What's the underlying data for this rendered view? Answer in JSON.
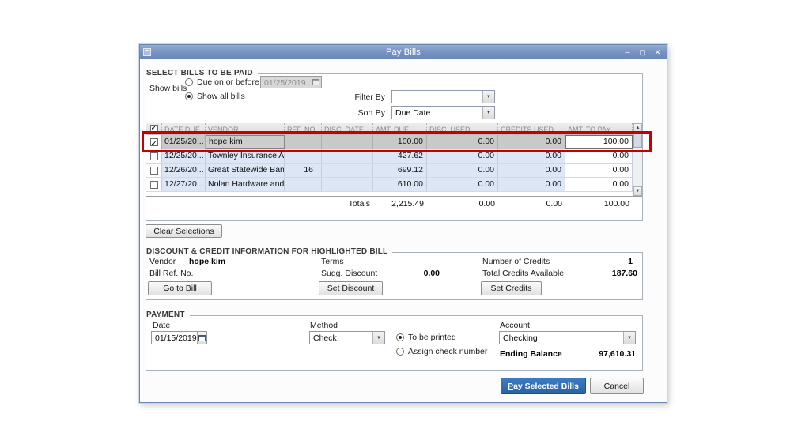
{
  "window": {
    "title": "Pay Bills"
  },
  "window_controls": {
    "minimize": "─",
    "maximize": "▢",
    "close": "✕"
  },
  "icons": {
    "chevron_down": "▼",
    "scroll_up": "▲",
    "scroll_down": "▼",
    "checkmark": "✓"
  },
  "select_bills": {
    "section_label": "SELECT BILLS TO BE PAID",
    "show_bills_label": "Show bills",
    "due_on_or_before": {
      "label": "Due on or before",
      "selected": false,
      "date": "01/25/2019"
    },
    "show_all_bills": {
      "label": "Show all bills",
      "selected": true
    },
    "filter_by": {
      "label": "Filter By",
      "value": ""
    },
    "sort_by": {
      "label": "Sort By",
      "value": "Due Date"
    },
    "clear_selections_label": "Clear Selections"
  },
  "table": {
    "header_checkbox_checked": true,
    "headers": {
      "date_due": "DATE DUE",
      "vendor": "VENDOR",
      "ref_no": "REF. NO.",
      "disc_date": "DISC. DATE",
      "amt_due": "AMT. DUE",
      "disc_used": "DISC. USED",
      "credits_used": "CREDITS USED",
      "amt_to_pay": "AMT. TO PAY"
    },
    "rows": [
      {
        "checked": true,
        "selected": true,
        "date_due": "01/25/20...",
        "vendor": "hope kim",
        "ref_no": "",
        "disc_date": "",
        "amt_due": "100.00",
        "disc_used": "0.00",
        "credits_used": "0.00",
        "amt_to_pay": "100.00"
      },
      {
        "checked": false,
        "selected": false,
        "date_due": "12/25/20...",
        "vendor": "Townley Insurance A...",
        "ref_no": "",
        "disc_date": "",
        "amt_due": "427.62",
        "disc_used": "0.00",
        "credits_used": "0.00",
        "amt_to_pay": "0.00"
      },
      {
        "checked": false,
        "selected": false,
        "date_due": "12/26/20...",
        "vendor": "Great Statewide Bank",
        "ref_no": "16",
        "disc_date": "",
        "amt_due": "699.12",
        "disc_used": "0.00",
        "credits_used": "0.00",
        "amt_to_pay": "0.00"
      },
      {
        "checked": false,
        "selected": false,
        "date_due": "12/27/20...",
        "vendor": "Nolan Hardware and ...",
        "ref_no": "",
        "disc_date": "",
        "amt_due": "610.00",
        "disc_used": "0.00",
        "credits_used": "0.00",
        "amt_to_pay": "0.00"
      }
    ],
    "totals": {
      "label": "Totals",
      "amt_due": "2,215.49",
      "disc_used": "0.00",
      "credits_used": "0.00",
      "amt_to_pay": "100.00"
    }
  },
  "discount_credit": {
    "section_label": "DISCOUNT & CREDIT INFORMATION FOR HIGHLIGHTED BILL",
    "vendor_label": "Vendor",
    "vendor_value": "hope kim",
    "bill_ref_no_label": "Bill Ref. No.",
    "terms_label": "Terms",
    "sugg_discount_label": "Sugg. Discount",
    "sugg_discount_value": "0.00",
    "number_of_credits_label": "Number of Credits",
    "number_of_credits_value": "1",
    "total_credits_available_label": "Total Credits Available",
    "total_credits_available_value": "187.60",
    "go_to_bill_label": "Go to Bill",
    "set_discount_label": "Set Discount",
    "set_credits_label": "Set Credits"
  },
  "payment": {
    "section_label": "PAYMENT",
    "date_label": "Date",
    "date_value": "01/15/2019",
    "method_label": "Method",
    "method_value": "Check",
    "to_be_printed": {
      "label": "To be printed",
      "selected": true
    },
    "assign_check_number": {
      "label": "Assign check number",
      "selected": false
    },
    "account_label": "Account",
    "account_value": "Checking",
    "ending_balance_label": "Ending Balance",
    "ending_balance_value": "97,610.31"
  },
  "footer": {
    "pay_selected_bills_label": "Pay Selected Bills",
    "cancel_label": "Cancel"
  }
}
